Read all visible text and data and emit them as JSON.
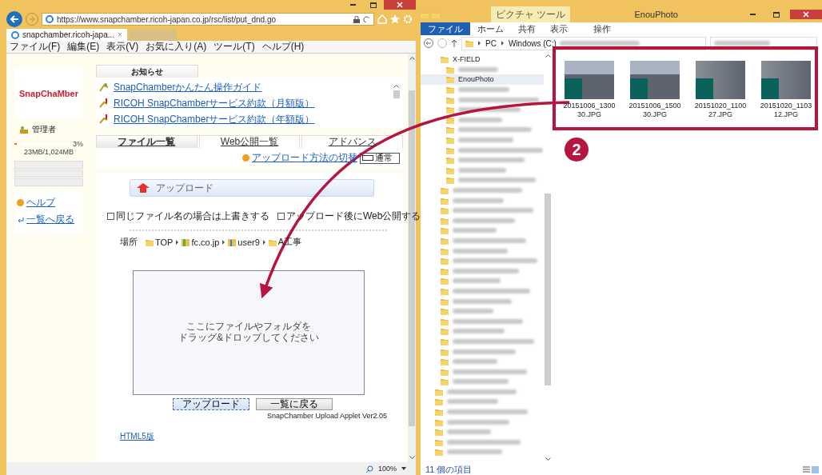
{
  "browser": {
    "address": {
      "url": "https://www.snapchamber.ricoh-japan.co.jp/rsc/list/put_dnd.go"
    },
    "tab": {
      "title": "snapchamber.ricoh-japa...",
      "close": "×"
    },
    "menu": [
      "ファイル(F)",
      "編集(E)",
      "表示(V)",
      "お気に入り(A)",
      "ツール(T)",
      "ヘルプ(H)"
    ],
    "sidebar": {
      "logo": "SnapChaMber",
      "user": "管理者",
      "storage": {
        "percent": "3%",
        "level": 0.03,
        "usage": "23MB/1,024MB"
      },
      "links": [
        "ヘルプ",
        "一覧へ戻る"
      ]
    },
    "notices": {
      "title": "お知らせ",
      "items": [
        {
          "kind": "guide",
          "text": "SnapChamberかんたん操作ガイド"
        },
        {
          "kind": "alert",
          "text": "RICOH SnapChamberサービス約款（月額版）"
        },
        {
          "kind": "alert",
          "text": "RICOH SnapChamberサービス約款（年額版）"
        }
      ]
    },
    "tabs": [
      {
        "label": "ファイル一覧",
        "selected": true
      },
      {
        "label": "Web公開一覧",
        "selected": false
      },
      {
        "label": "アドバンス",
        "selected": false
      }
    ],
    "toggle": {
      "link": "アップロード方法の切替",
      "mode": "通常"
    },
    "upload": {
      "header": "アップロード",
      "options": [
        {
          "label": "同じファイル名の場合は上書きする",
          "checked": false
        },
        {
          "label": "アップロード後にWeb公開する",
          "checked": false
        }
      ],
      "location_label": "場所",
      "path": [
        {
          "kind": "folder",
          "name": "TOP"
        },
        {
          "kind": "company",
          "name": "fc.co.jp"
        },
        {
          "kind": "user",
          "name": "user9"
        },
        {
          "kind": "folder",
          "name": "A工事"
        }
      ],
      "dropzone": [
        "ここにファイルやフォルダを",
        "ドラッグ&ドロップしてください"
      ],
      "buttons": [
        {
          "label": "アップロード",
          "selected": true
        },
        {
          "label": "一覧に戻る",
          "selected": false
        }
      ],
      "version": "SnapChamber Upload Applet Ver2.05",
      "html5_link": "HTML5版"
    },
    "status": {
      "zoom": "100%"
    }
  },
  "explorer": {
    "context_tab": "ピクチャ ツール",
    "title": "EnouPhoto",
    "ribbon_tabs": [
      {
        "label": "ファイル",
        "selected": true
      },
      {
        "label": "ホーム",
        "selected": false
      },
      {
        "label": "共有",
        "selected": false
      },
      {
        "label": "表示",
        "selected": false
      },
      {
        "label": "操作",
        "selected": false
      }
    ],
    "address": [
      "PC",
      "Windows (C:)"
    ],
    "tree": [
      {
        "kind": "group",
        "children": [
          {
            "kind": "folder",
            "label": "X-FIELD",
            "selected": false,
            "children": [
              {
                "kind": "blurred"
              },
              {
                "kind": "folder",
                "label": "EnouPhoto",
                "selected": true
              },
              {
                "kind": "blurred"
              },
              {
                "kind": "blurred"
              },
              {
                "kind": "blurred"
              },
              {
                "kind": "blurred"
              },
              {
                "kind": "blurred"
              },
              {
                "kind": "blurred"
              },
              {
                "kind": "blurred"
              },
              {
                "kind": "blurred"
              },
              {
                "kind": "blurred"
              },
              {
                "kind": "blurred"
              }
            ]
          },
          {
            "kind": "blurred"
          },
          {
            "kind": "blurred"
          },
          {
            "kind": "blurred"
          },
          {
            "kind": "blurred"
          },
          {
            "kind": "blurred"
          },
          {
            "kind": "blurred"
          },
          {
            "kind": "blurred"
          },
          {
            "kind": "blurred"
          },
          {
            "kind": "blurred"
          },
          {
            "kind": "blurred"
          },
          {
            "kind": "blurred"
          },
          {
            "kind": "blurred"
          },
          {
            "kind": "blurred"
          },
          {
            "kind": "blurred"
          },
          {
            "kind": "blurred"
          },
          {
            "kind": "blurred"
          },
          {
            "kind": "blurred"
          },
          {
            "kind": "blurred"
          },
          {
            "kind": "blurred"
          },
          {
            "kind": "blurred"
          }
        ]
      },
      {
        "kind": "blurred"
      },
      {
        "kind": "blurred"
      },
      {
        "kind": "blurred"
      },
      {
        "kind": "blurred"
      },
      {
        "kind": "blurred"
      },
      {
        "kind": "blurred"
      },
      {
        "kind": "blurred"
      }
    ],
    "files": [
      {
        "kind": "road",
        "name": "20151006_130030.JPG"
      },
      {
        "kind": "road",
        "name": "20151006_150030.JPG"
      },
      {
        "kind": "worker",
        "name": "20151020_110027.JPG"
      },
      {
        "kind": "worker",
        "name": "20151020_110312.JPG"
      }
    ],
    "status": "11 個の項目"
  },
  "annotation": {
    "badge": "2"
  }
}
